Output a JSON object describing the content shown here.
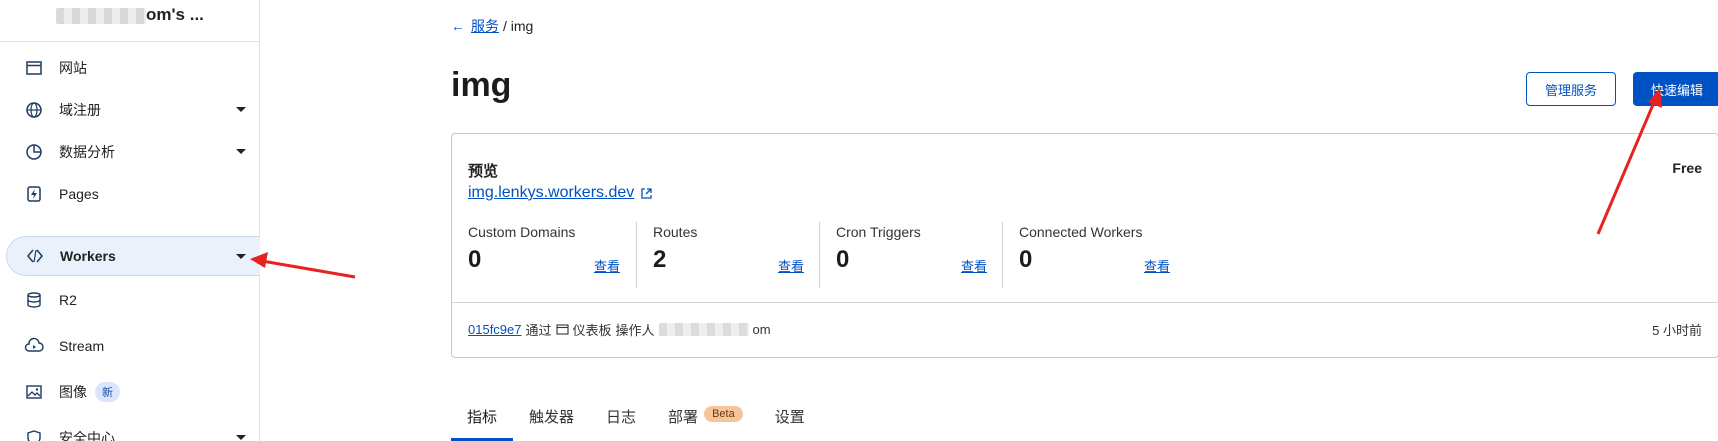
{
  "sidebar": {
    "account_name": "om's ...",
    "items": [
      {
        "label": "网站",
        "icon": "window-icon"
      },
      {
        "label": "域注册",
        "icon": "globe-icon"
      },
      {
        "label": "数据分析",
        "icon": "pie-chart-icon"
      },
      {
        "label": "Pages",
        "icon": "bolt-page-icon"
      },
      {
        "label": "Workers",
        "icon": "workers-icon"
      },
      {
        "label": "R2",
        "icon": "database-icon"
      },
      {
        "label": "Stream",
        "icon": "cloud-play-icon"
      },
      {
        "label": "图像",
        "icon": "image-icon",
        "badge": "新"
      },
      {
        "label": "安全中心",
        "icon": "shield-icon"
      }
    ]
  },
  "breadcrumb": {
    "back_label": "服务",
    "current": "/ img"
  },
  "page": {
    "title": "img"
  },
  "actions": {
    "manage_label": "管理服务",
    "quick_edit_label": "快速编辑"
  },
  "card": {
    "preview_label": "预览",
    "plan": "Free",
    "url": "img.lenkys.workers.dev",
    "stats": [
      {
        "label": "Custom Domains",
        "value": "0",
        "link": "查看"
      },
      {
        "label": "Routes",
        "value": "2",
        "link": "查看"
      },
      {
        "label": "Cron Triggers",
        "value": "0",
        "link": "查看"
      },
      {
        "label": "Connected Workers",
        "value": "0",
        "link": "查看"
      }
    ],
    "footer": {
      "hash": "015fc9e7",
      "via": "通过",
      "dashboard": "仪表板",
      "operator": "操作人",
      "operator_suffix": "om",
      "time": "5 小时前"
    }
  },
  "tabs": [
    {
      "label": "指标"
    },
    {
      "label": "触发器"
    },
    {
      "label": "日志"
    },
    {
      "label": "部署",
      "badge": "Beta"
    },
    {
      "label": "设置"
    }
  ],
  "colors": {
    "accent": "#0051c3",
    "annotation": "#e8231f"
  }
}
